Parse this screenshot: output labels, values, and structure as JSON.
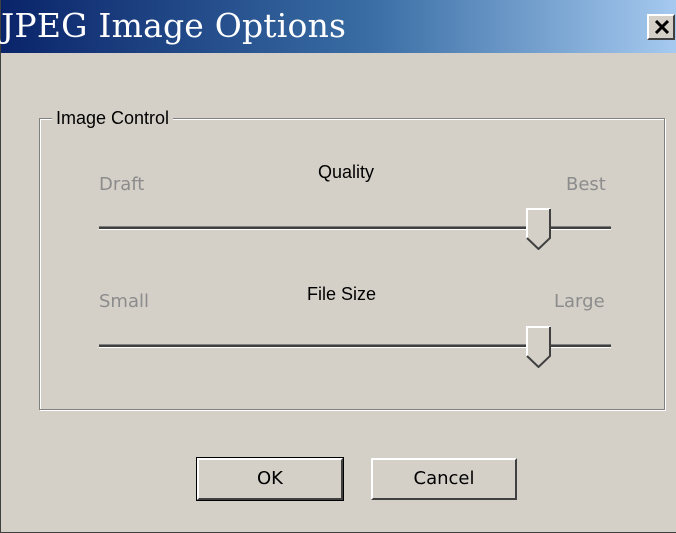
{
  "window": {
    "title": "JPEG Image Options",
    "close_icon": "close-icon"
  },
  "group": {
    "label": "Image Control"
  },
  "quality": {
    "label": "Quality",
    "min_label": "Draft",
    "max_label": "Best",
    "value_fraction": 0.86
  },
  "file_size": {
    "label": "File Size",
    "min_label": "Small",
    "max_label": "Large",
    "value_fraction": 0.86
  },
  "buttons": {
    "ok": "OK",
    "cancel": "Cancel"
  },
  "colors": {
    "face": "#d4d0c8",
    "title_start": "#0a246a",
    "title_end": "#a6caf0",
    "disabled_text": "#8c8c8c"
  }
}
